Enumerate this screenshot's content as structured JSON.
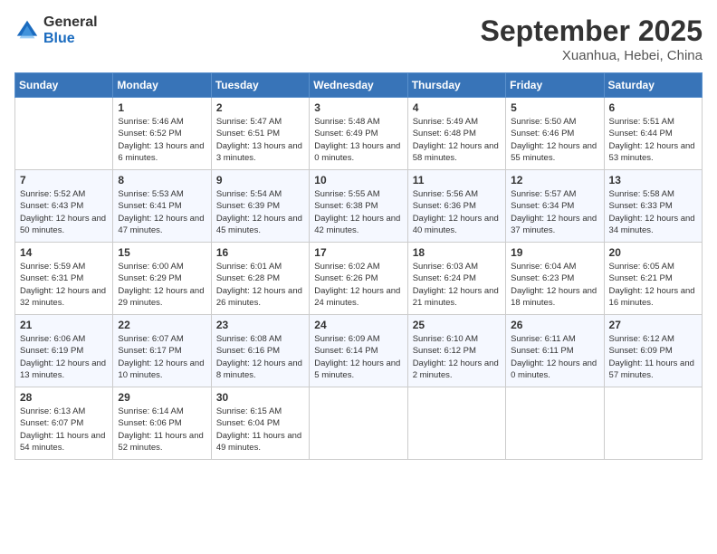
{
  "header": {
    "logo_line1": "General",
    "logo_line2": "Blue",
    "month": "September 2025",
    "location": "Xuanhua, Hebei, China"
  },
  "days_of_week": [
    "Sunday",
    "Monday",
    "Tuesday",
    "Wednesday",
    "Thursday",
    "Friday",
    "Saturday"
  ],
  "weeks": [
    [
      {
        "day": "",
        "sunrise": "",
        "sunset": "",
        "daylight": ""
      },
      {
        "day": "1",
        "sunrise": "Sunrise: 5:46 AM",
        "sunset": "Sunset: 6:52 PM",
        "daylight": "Daylight: 13 hours and 6 minutes."
      },
      {
        "day": "2",
        "sunrise": "Sunrise: 5:47 AM",
        "sunset": "Sunset: 6:51 PM",
        "daylight": "Daylight: 13 hours and 3 minutes."
      },
      {
        "day": "3",
        "sunrise": "Sunrise: 5:48 AM",
        "sunset": "Sunset: 6:49 PM",
        "daylight": "Daylight: 13 hours and 0 minutes."
      },
      {
        "day": "4",
        "sunrise": "Sunrise: 5:49 AM",
        "sunset": "Sunset: 6:48 PM",
        "daylight": "Daylight: 12 hours and 58 minutes."
      },
      {
        "day": "5",
        "sunrise": "Sunrise: 5:50 AM",
        "sunset": "Sunset: 6:46 PM",
        "daylight": "Daylight: 12 hours and 55 minutes."
      },
      {
        "day": "6",
        "sunrise": "Sunrise: 5:51 AM",
        "sunset": "Sunset: 6:44 PM",
        "daylight": "Daylight: 12 hours and 53 minutes."
      }
    ],
    [
      {
        "day": "7",
        "sunrise": "Sunrise: 5:52 AM",
        "sunset": "Sunset: 6:43 PM",
        "daylight": "Daylight: 12 hours and 50 minutes."
      },
      {
        "day": "8",
        "sunrise": "Sunrise: 5:53 AM",
        "sunset": "Sunset: 6:41 PM",
        "daylight": "Daylight: 12 hours and 47 minutes."
      },
      {
        "day": "9",
        "sunrise": "Sunrise: 5:54 AM",
        "sunset": "Sunset: 6:39 PM",
        "daylight": "Daylight: 12 hours and 45 minutes."
      },
      {
        "day": "10",
        "sunrise": "Sunrise: 5:55 AM",
        "sunset": "Sunset: 6:38 PM",
        "daylight": "Daylight: 12 hours and 42 minutes."
      },
      {
        "day": "11",
        "sunrise": "Sunrise: 5:56 AM",
        "sunset": "Sunset: 6:36 PM",
        "daylight": "Daylight: 12 hours and 40 minutes."
      },
      {
        "day": "12",
        "sunrise": "Sunrise: 5:57 AM",
        "sunset": "Sunset: 6:34 PM",
        "daylight": "Daylight: 12 hours and 37 minutes."
      },
      {
        "day": "13",
        "sunrise": "Sunrise: 5:58 AM",
        "sunset": "Sunset: 6:33 PM",
        "daylight": "Daylight: 12 hours and 34 minutes."
      }
    ],
    [
      {
        "day": "14",
        "sunrise": "Sunrise: 5:59 AM",
        "sunset": "Sunset: 6:31 PM",
        "daylight": "Daylight: 12 hours and 32 minutes."
      },
      {
        "day": "15",
        "sunrise": "Sunrise: 6:00 AM",
        "sunset": "Sunset: 6:29 PM",
        "daylight": "Daylight: 12 hours and 29 minutes."
      },
      {
        "day": "16",
        "sunrise": "Sunrise: 6:01 AM",
        "sunset": "Sunset: 6:28 PM",
        "daylight": "Daylight: 12 hours and 26 minutes."
      },
      {
        "day": "17",
        "sunrise": "Sunrise: 6:02 AM",
        "sunset": "Sunset: 6:26 PM",
        "daylight": "Daylight: 12 hours and 24 minutes."
      },
      {
        "day": "18",
        "sunrise": "Sunrise: 6:03 AM",
        "sunset": "Sunset: 6:24 PM",
        "daylight": "Daylight: 12 hours and 21 minutes."
      },
      {
        "day": "19",
        "sunrise": "Sunrise: 6:04 AM",
        "sunset": "Sunset: 6:23 PM",
        "daylight": "Daylight: 12 hours and 18 minutes."
      },
      {
        "day": "20",
        "sunrise": "Sunrise: 6:05 AM",
        "sunset": "Sunset: 6:21 PM",
        "daylight": "Daylight: 12 hours and 16 minutes."
      }
    ],
    [
      {
        "day": "21",
        "sunrise": "Sunrise: 6:06 AM",
        "sunset": "Sunset: 6:19 PM",
        "daylight": "Daylight: 12 hours and 13 minutes."
      },
      {
        "day": "22",
        "sunrise": "Sunrise: 6:07 AM",
        "sunset": "Sunset: 6:17 PM",
        "daylight": "Daylight: 12 hours and 10 minutes."
      },
      {
        "day": "23",
        "sunrise": "Sunrise: 6:08 AM",
        "sunset": "Sunset: 6:16 PM",
        "daylight": "Daylight: 12 hours and 8 minutes."
      },
      {
        "day": "24",
        "sunrise": "Sunrise: 6:09 AM",
        "sunset": "Sunset: 6:14 PM",
        "daylight": "Daylight: 12 hours and 5 minutes."
      },
      {
        "day": "25",
        "sunrise": "Sunrise: 6:10 AM",
        "sunset": "Sunset: 6:12 PM",
        "daylight": "Daylight: 12 hours and 2 minutes."
      },
      {
        "day": "26",
        "sunrise": "Sunrise: 6:11 AM",
        "sunset": "Sunset: 6:11 PM",
        "daylight": "Daylight: 12 hours and 0 minutes."
      },
      {
        "day": "27",
        "sunrise": "Sunrise: 6:12 AM",
        "sunset": "Sunset: 6:09 PM",
        "daylight": "Daylight: 11 hours and 57 minutes."
      }
    ],
    [
      {
        "day": "28",
        "sunrise": "Sunrise: 6:13 AM",
        "sunset": "Sunset: 6:07 PM",
        "daylight": "Daylight: 11 hours and 54 minutes."
      },
      {
        "day": "29",
        "sunrise": "Sunrise: 6:14 AM",
        "sunset": "Sunset: 6:06 PM",
        "daylight": "Daylight: 11 hours and 52 minutes."
      },
      {
        "day": "30",
        "sunrise": "Sunrise: 6:15 AM",
        "sunset": "Sunset: 6:04 PM",
        "daylight": "Daylight: 11 hours and 49 minutes."
      },
      {
        "day": "",
        "sunrise": "",
        "sunset": "",
        "daylight": ""
      },
      {
        "day": "",
        "sunrise": "",
        "sunset": "",
        "daylight": ""
      },
      {
        "day": "",
        "sunrise": "",
        "sunset": "",
        "daylight": ""
      },
      {
        "day": "",
        "sunrise": "",
        "sunset": "",
        "daylight": ""
      }
    ]
  ]
}
